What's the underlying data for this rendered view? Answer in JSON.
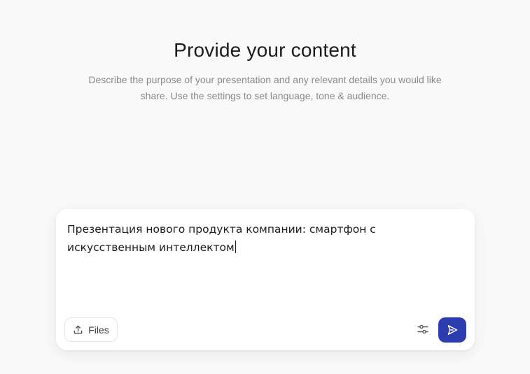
{
  "header": {
    "title": "Provide your content",
    "subtitle": "Describe the purpose of your presentation and any relevant details you would like share. Use the settings to set language, tone & audience."
  },
  "composer": {
    "value": "Презентация нового продукта компании: смартфон с искусственным интеллектом",
    "files_label": "Files"
  },
  "icons": {
    "files": "upload-icon",
    "settings": "sliders-icon",
    "send": "send-icon"
  },
  "colors": {
    "background": "#f9f9f9",
    "accent": "#2b3cae",
    "text": "#1c1c1c",
    "muted": "#8a8a8a"
  }
}
